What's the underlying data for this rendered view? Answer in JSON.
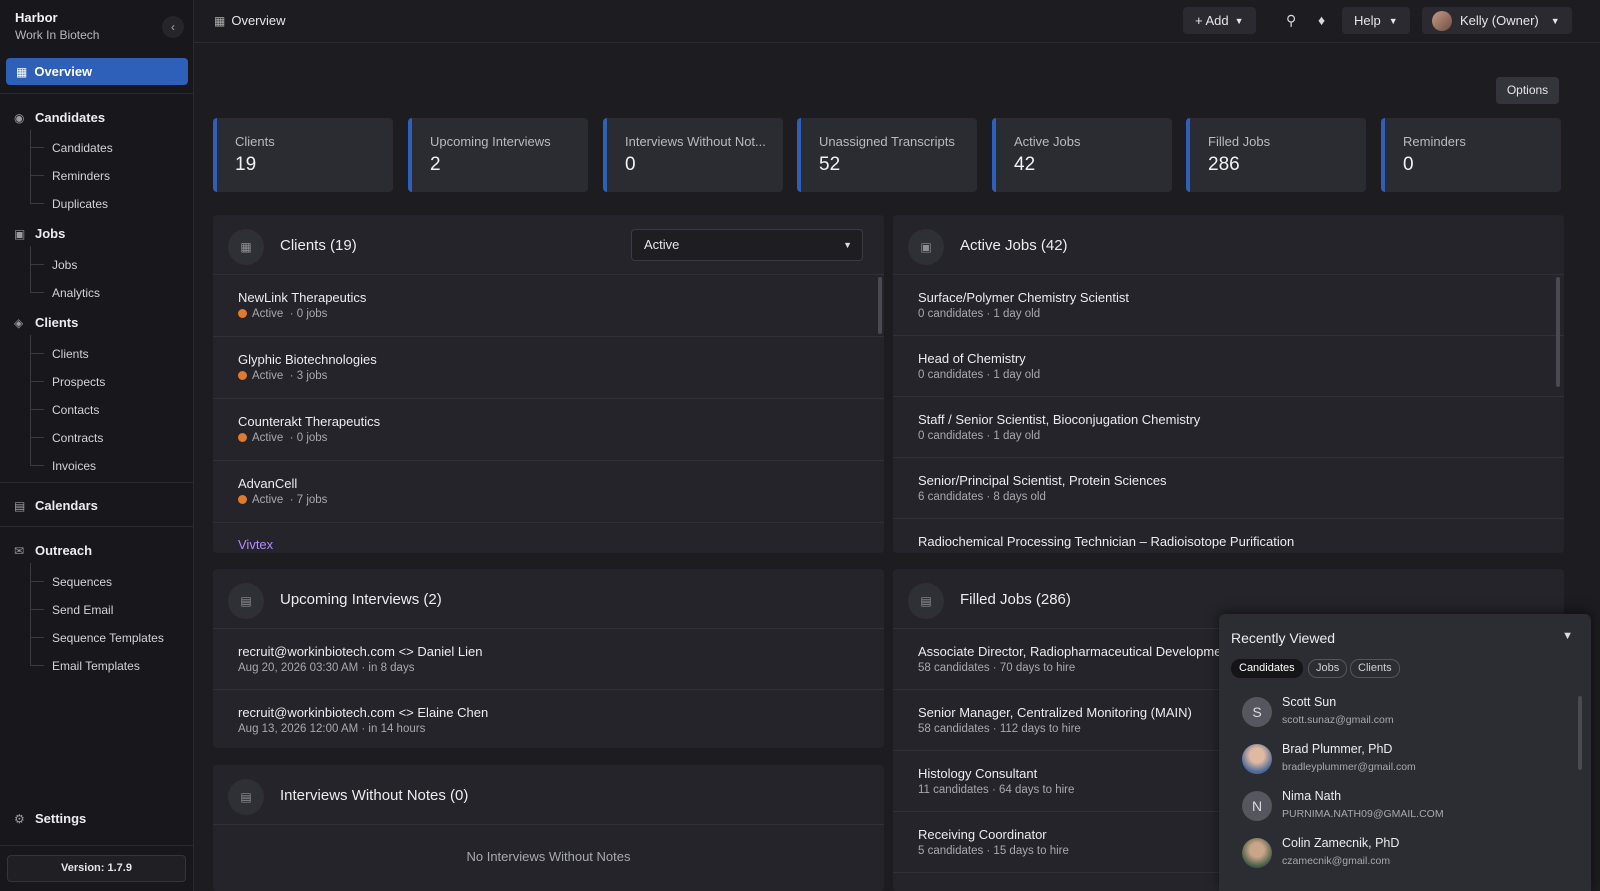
{
  "brand": {
    "name": "Harbor",
    "subtitle": "Work In Biotech"
  },
  "sidebar": {
    "active": "Overview",
    "sections": [
      {
        "label": "Candidates",
        "icon": "candidates-icon",
        "items": [
          "Candidates",
          "Reminders",
          "Duplicates"
        ]
      },
      {
        "label": "Jobs",
        "icon": "briefcase-icon",
        "items": [
          "Jobs",
          "Analytics"
        ]
      },
      {
        "label": "Clients",
        "icon": "clients-icon",
        "items": [
          "Clients",
          "Prospects",
          "Contacts",
          "Contracts",
          "Invoices"
        ]
      },
      {
        "label": "Calendars",
        "icon": "calendar-icon",
        "items": []
      },
      {
        "label": "Outreach",
        "icon": "outreach-icon",
        "items": [
          "Sequences",
          "Send Email",
          "Sequence Templates",
          "Email Templates"
        ]
      }
    ],
    "settings": "Settings",
    "version": "Version: 1.7.9"
  },
  "topbar": {
    "title": "Overview",
    "add_label": "+ Add",
    "help_label": "Help",
    "user_label": "Kelly (Owner)"
  },
  "options_label": "Options",
  "stats": [
    {
      "label": "Clients",
      "value": "19"
    },
    {
      "label": "Upcoming Interviews",
      "value": "2"
    },
    {
      "label": "Interviews Without Not...",
      "value": "0"
    },
    {
      "label": "Unassigned Transcripts",
      "value": "52"
    },
    {
      "label": "Active Jobs",
      "value": "42"
    },
    {
      "label": "Filled Jobs",
      "value": "286"
    },
    {
      "label": "Reminders",
      "value": "0"
    }
  ],
  "clients_panel": {
    "title": "Clients (19)",
    "filter": "Active",
    "rows": [
      {
        "name": "NewLink Therapeutics",
        "status": "Active",
        "jobs": "· 0 jobs"
      },
      {
        "name": "Glyphic Biotechnologies",
        "status": "Active",
        "jobs": "· 3 jobs"
      },
      {
        "name": "Counterakt Therapeutics",
        "status": "Active",
        "jobs": "· 0 jobs"
      },
      {
        "name": "AdvanCell",
        "status": "Active",
        "jobs": "· 7 jobs"
      },
      {
        "name": "Vivtex",
        "status": "",
        "jobs": ""
      }
    ]
  },
  "active_jobs_panel": {
    "title": "Active Jobs (42)",
    "rows": [
      {
        "title": "Surface/Polymer Chemistry Scientist",
        "meta": "0 candidates · 1 day old"
      },
      {
        "title": "Head of Chemistry",
        "meta": "0 candidates · 1 day old"
      },
      {
        "title": "Staff / Senior Scientist, Bioconjugation Chemistry",
        "meta": "0 candidates · 1 day old"
      },
      {
        "title": "Senior/Principal Scientist, Protein Sciences",
        "meta": "6 candidates · 8 days old"
      },
      {
        "title": "Radiochemical Processing Technician – Radioisotope Purification",
        "meta": ""
      }
    ]
  },
  "interviews_panel": {
    "title": "Upcoming Interviews (2)",
    "rows": [
      {
        "title": "recruit@workinbiotech.com <> Daniel Lien",
        "meta": "Aug 20, 2026 03:30 AM · in 8 days"
      },
      {
        "title": "recruit@workinbiotech.com <> Elaine Chen",
        "meta": "Aug 13, 2026 12:00 AM · in 14 hours"
      }
    ]
  },
  "no_notes_panel": {
    "title": "Interviews Without Notes (0)",
    "empty": "No Interviews Without Notes"
  },
  "filled_jobs_panel": {
    "title": "Filled Jobs (286)",
    "rows": [
      {
        "title": "Associate Director, Radiopharmaceutical Development",
        "meta": "58 candidates · 70 days to hire"
      },
      {
        "title": "Senior Manager, Centralized Monitoring (MAIN)",
        "meta": "58 candidates · 112 days to hire"
      },
      {
        "title": "Histology Consultant",
        "meta": "11 candidates · 64 days to hire"
      },
      {
        "title": "Receiving Coordinator",
        "meta": "5 candidates · 15 days to hire"
      }
    ]
  },
  "recently_viewed": {
    "title": "Recently Viewed",
    "tabs": [
      "Candidates",
      "Jobs",
      "Clients"
    ],
    "active_tab": "Candidates",
    "items": [
      {
        "initial": "S",
        "name": "Scott Sun",
        "email": "scott.sunaz@gmail.com"
      },
      {
        "initial": "",
        "name": "Brad Plummer, PhD",
        "email": "bradleyplummer@gmail.com"
      },
      {
        "initial": "N",
        "name": "Nima Nath",
        "email": "PURNIMA.NATH09@GMAIL.COM"
      },
      {
        "initial": "",
        "name": "Colin Zamecnik, PhD",
        "email": "czamecnik@gmail.com"
      }
    ]
  },
  "colors": {
    "accent": "#2e5fb9",
    "status_active": "#e07a2e",
    "link": "#b28cff"
  }
}
